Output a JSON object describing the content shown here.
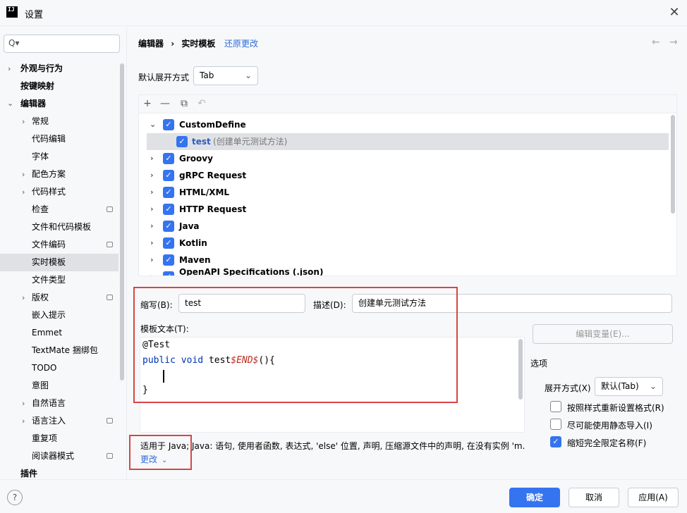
{
  "window": {
    "title": "设置"
  },
  "search": {
    "placeholder": "Q▾"
  },
  "sidebar": {
    "items": [
      {
        "label": "外观与行为"
      },
      {
        "label": "按键映射"
      },
      {
        "label": "编辑器"
      },
      {
        "label": "常规"
      },
      {
        "label": "代码编辑"
      },
      {
        "label": "字体"
      },
      {
        "label": "配色方案"
      },
      {
        "label": "代码样式"
      },
      {
        "label": "检查"
      },
      {
        "label": "文件和代码模板"
      },
      {
        "label": "文件编码"
      },
      {
        "label": "实时模板"
      },
      {
        "label": "文件类型"
      },
      {
        "label": "版权"
      },
      {
        "label": "嵌入提示"
      },
      {
        "label": "Emmet"
      },
      {
        "label": "TextMate 捆绑包"
      },
      {
        "label": "TODO"
      },
      {
        "label": "意图"
      },
      {
        "label": "自然语言"
      },
      {
        "label": "语言注入"
      },
      {
        "label": "重复项"
      },
      {
        "label": "阅读器模式"
      },
      {
        "label": "插件"
      }
    ]
  },
  "breadcrumb": {
    "part1": "编辑器",
    "sep": "›",
    "part2": "实时模板",
    "revert": "还原更改"
  },
  "nav": {
    "back": "←",
    "forward": "→"
  },
  "expand": {
    "label": "默认展开方式",
    "value": "Tab"
  },
  "toolbar": {
    "add": "+",
    "remove": "—",
    "copy": "⧉",
    "undo": "↶"
  },
  "templates": [
    {
      "name": "CustomDefine"
    },
    {
      "abbr": "test",
      "desc": "(创建单元测试方法)"
    },
    {
      "name": "Groovy"
    },
    {
      "name": "gRPC Request"
    },
    {
      "name": "HTML/XML"
    },
    {
      "name": "HTTP Request"
    },
    {
      "name": "Java"
    },
    {
      "name": "Kotlin"
    },
    {
      "name": "Maven"
    },
    {
      "name": "OpenAPI Specifications (.json)"
    }
  ],
  "editor": {
    "abbr_label": "缩写(B):",
    "abbr_value": "test",
    "desc_label": "描述(D):",
    "desc_value": "创建单元测试方法",
    "text_label": "模板文本(T):",
    "edit_vars": "编辑变量(E)...",
    "code": {
      "line1": "@Test",
      "kw1": "public",
      "kw2": "void",
      "name": "test",
      "var": "$END$",
      "rest": "(){",
      "close": "}"
    }
  },
  "options": {
    "title": "选项",
    "expand_label": "展开方式(X)",
    "expand_value": "默认(Tab)",
    "reformat": "按照样式重新设置格式(R)",
    "static_import": "尽可能使用静态导入(I)",
    "shorten_fqn": "缩短完全限定名称(F)"
  },
  "context": {
    "applicable": "适用于 Java; Java: 语句, 使用者函数, 表达式, 'else' 位置, 声明, 压缩源文件中的声明, 在没有实例 'm...",
    "change": "更改"
  },
  "footer": {
    "help": "?",
    "ok": "确定",
    "cancel": "取消",
    "apply": "应用(A)"
  }
}
